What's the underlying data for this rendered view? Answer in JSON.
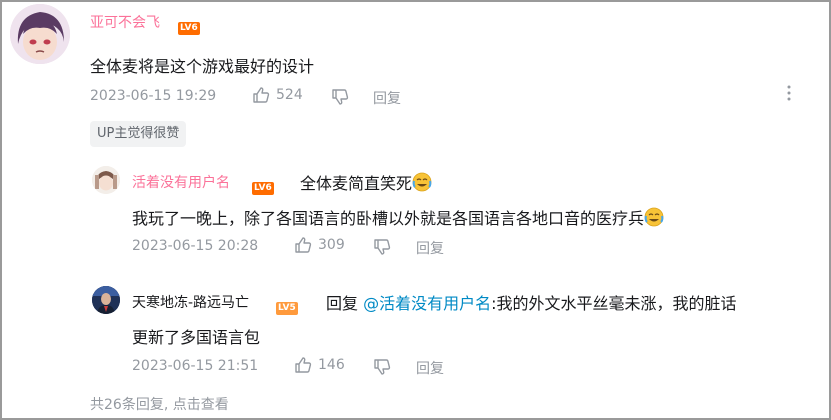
{
  "comment": {
    "username": "亚可不会飞",
    "level": "LV6",
    "text": "全体麦将是这个游戏最好的设计",
    "time": "2023-06-15 19:29",
    "likes": "524",
    "reply_label": "回复",
    "up_badge": "UP主觉得很赞"
  },
  "replies": [
    {
      "username": "活着没有用户名",
      "level": "LV6",
      "text_head": "全体麦简直笑死",
      "text_body": "我玩了一晚上，除了各国语言的卧槽以外就是各国语言各地口音的医疗兵",
      "time": "2023-06-15 20:28",
      "likes": "309",
      "reply_label": "回复"
    },
    {
      "username": "天寒地冻-路远马亡",
      "level": "LV5",
      "reply_prefix": "回复",
      "mention": "@活着没有用户名",
      "text_line1": ":我的外文水平丝毫未涨，我的脏话",
      "text_line2": "更新了多国语言包",
      "time": "2023-06-15 21:51",
      "likes": "146",
      "reply_label": "回复"
    }
  ],
  "footer": {
    "more": "共26条回复, 点击查看"
  },
  "colors": {
    "username_vip": "#fb7299",
    "lv6": "#ff6c00",
    "lv5": "#ff9a3c",
    "mention": "#008ac5",
    "meta": "#9499a0"
  }
}
